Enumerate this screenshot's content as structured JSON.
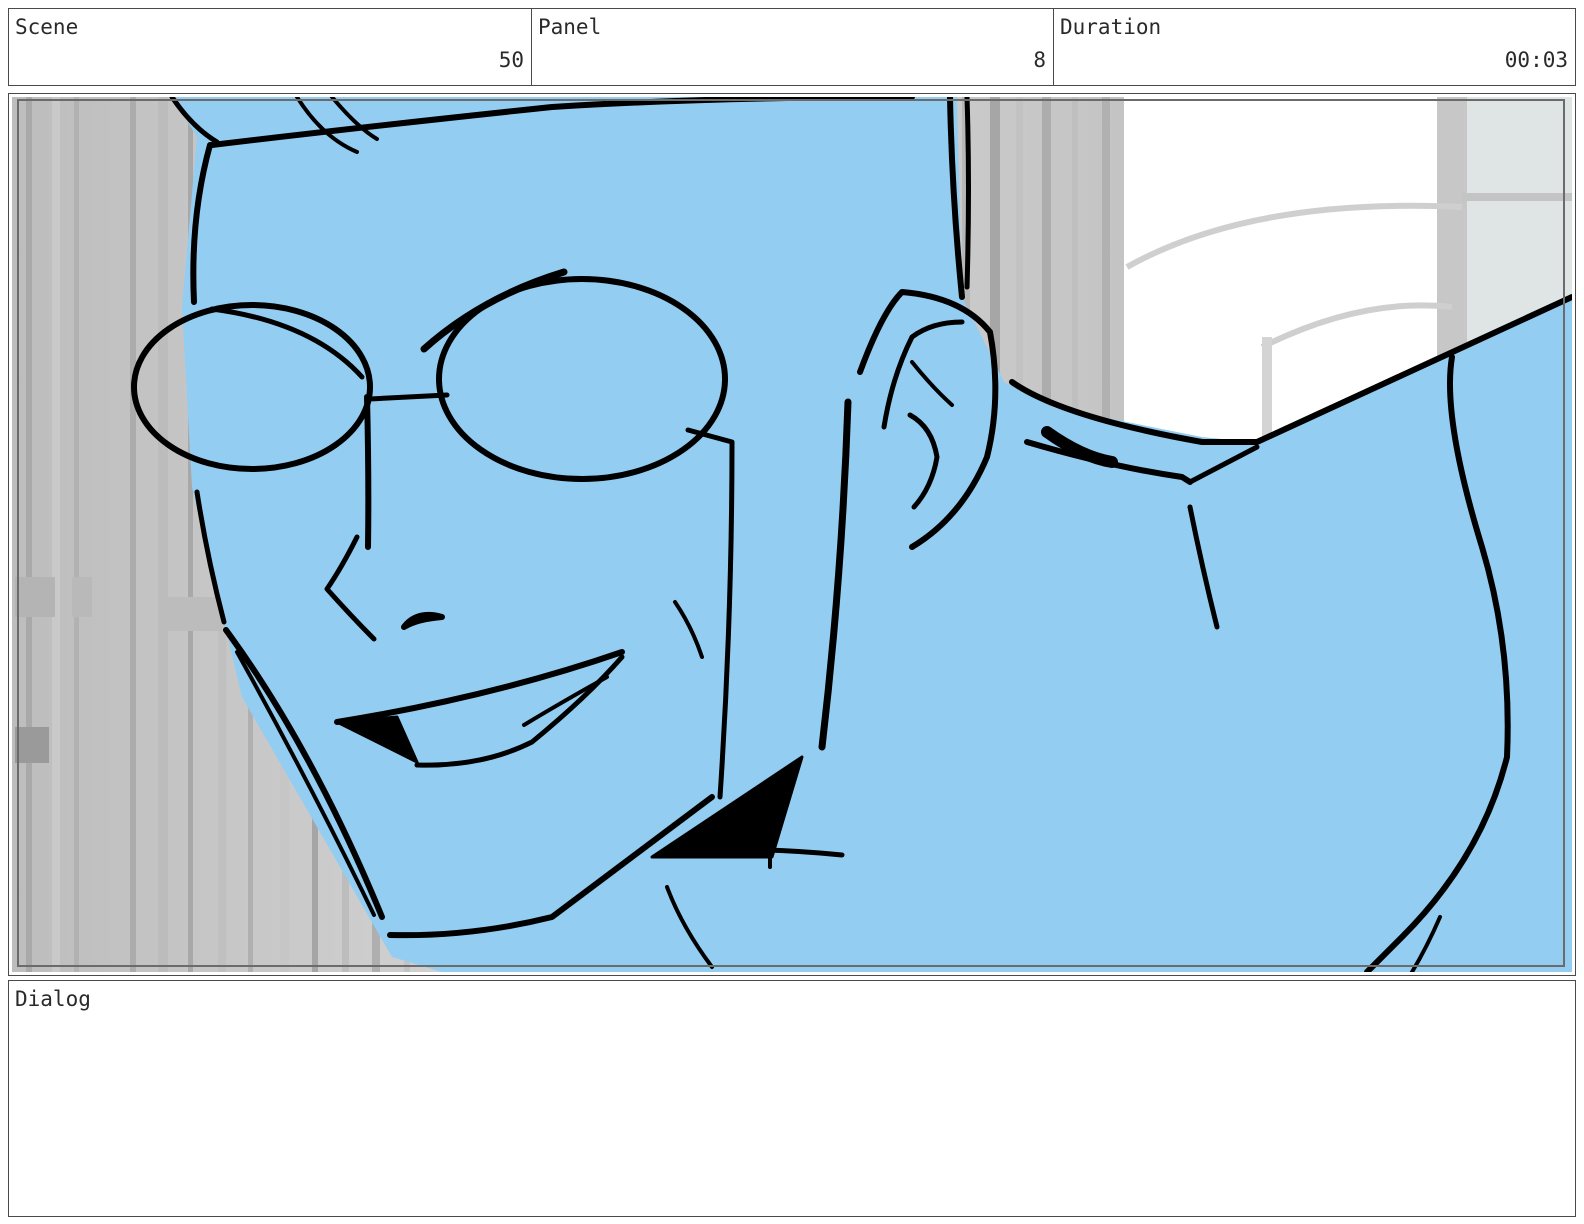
{
  "header": {
    "scene": {
      "label": "Scene",
      "value": "50"
    },
    "panel": {
      "label": "Panel",
      "value": "8"
    },
    "duration": {
      "label": "Duration",
      "value": "00:03"
    }
  },
  "dialog": {
    "label": "Dialog",
    "text": ""
  },
  "colors": {
    "border": "#4a4a4a",
    "figure_fill": "#93cdf1",
    "ink": "#000000",
    "background_stripes": "#c8c8c8"
  },
  "icons": {
    "storyboard_art": "sketch-of-smiling-man-with-round-glasses"
  }
}
